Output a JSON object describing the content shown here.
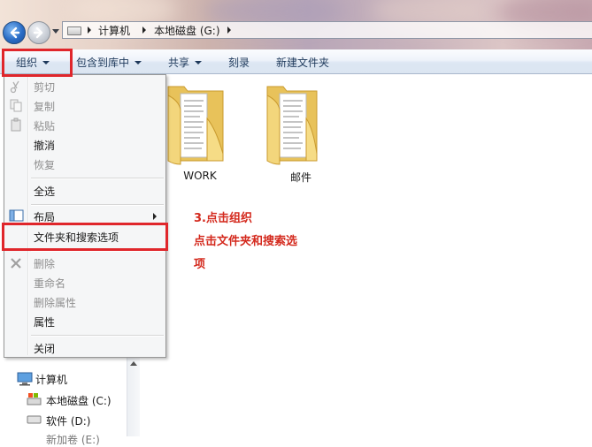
{
  "address_bar": {
    "segments": [
      "计算机",
      "本地磁盘 (G:)"
    ]
  },
  "toolbar": {
    "organize": "组织",
    "include_in_library": "包含到库中",
    "share": "共享",
    "burn": "刻录",
    "new_folder": "新建文件夹"
  },
  "organize_menu": {
    "cut": "剪切",
    "copy": "复制",
    "paste": "粘贴",
    "undo": "撤消",
    "redo": "恢复",
    "select_all": "全选",
    "layout": "布局",
    "folder_search_options": "文件夹和搜索选项",
    "delete": "删除",
    "rename": "重命名",
    "remove_properties": "删除属性",
    "properties": "属性",
    "close": "关闭"
  },
  "folders": [
    {
      "name": "WORK"
    },
    {
      "name": "邮件"
    }
  ],
  "annotation": {
    "line1": "3.点击组织",
    "line2": "点击文件夹和搜索选",
    "line3": "项"
  },
  "nav_pane": {
    "computer": "计算机",
    "drive_c": "本地磁盘 (C:)",
    "drive_d": "软件 (D:)",
    "drive_e_partial": "新加卷 (E:)"
  },
  "colors": {
    "highlight_red": "#e0262b",
    "annotation_red": "#d42a1e",
    "toolbar_text": "#1e395b"
  }
}
